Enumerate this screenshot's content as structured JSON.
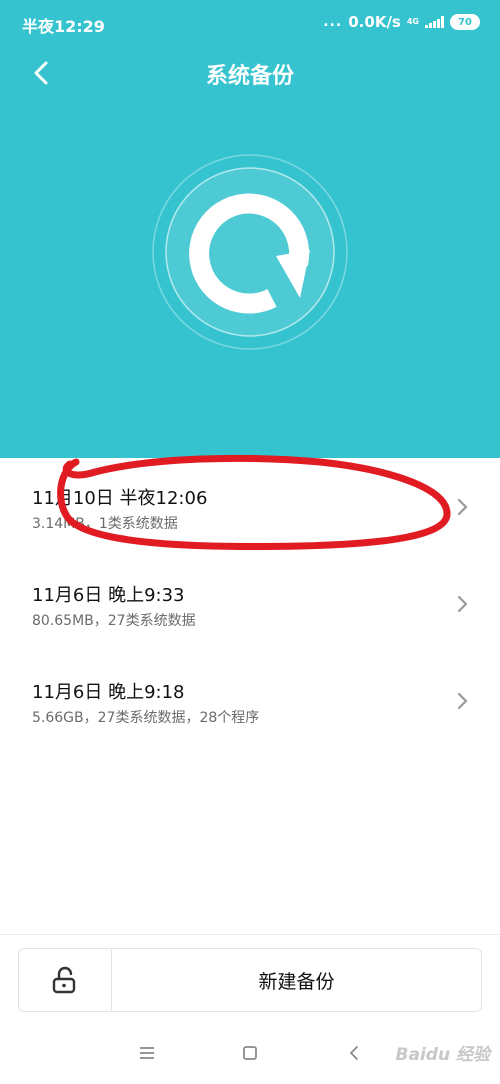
{
  "status_bar": {
    "time": "半夜12:29",
    "dots": "...",
    "net_speed": "0.0K/s",
    "network_type": "4G",
    "battery": "70"
  },
  "header": {
    "title": "系统备份"
  },
  "backups": [
    {
      "title": "11月10日 半夜12:06",
      "subtitle": "3.14MB，1类系统数据"
    },
    {
      "title": "11月6日 晚上9:33",
      "subtitle": "80.65MB，27类系统数据"
    },
    {
      "title": "11月6日 晚上9:18",
      "subtitle": "5.66GB，27类系统数据，28个程序"
    }
  ],
  "action_bar": {
    "new_backup_label": "新建备份"
  },
  "watermark": "Baidu 经验",
  "colors": {
    "accent": "#35c3cf",
    "annotation": "#e11b22"
  },
  "icons": {
    "back": "back-arrow-icon",
    "hero": "backup-sync-icon",
    "row_chevron": "chevron-right-icon",
    "lock": "unlock-icon",
    "nav_menu": "menu-icon",
    "nav_home": "home-icon",
    "nav_back": "nav-back-icon"
  }
}
